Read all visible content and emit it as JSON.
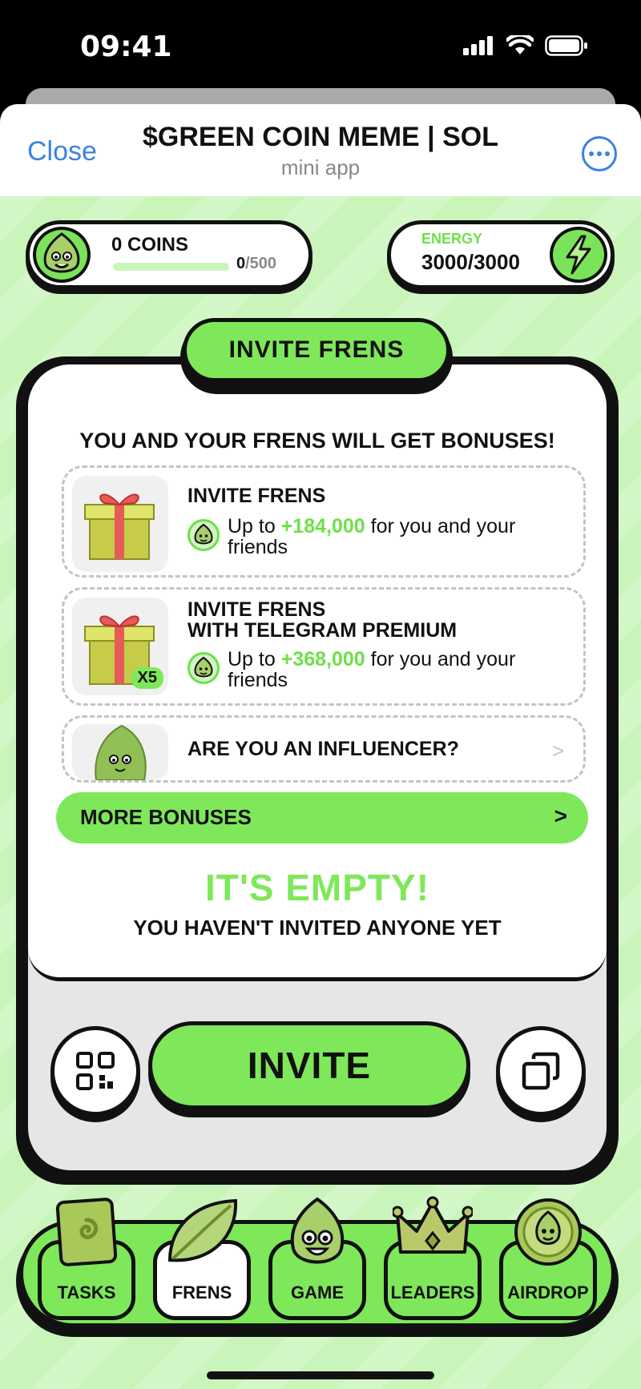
{
  "status_bar": {
    "time": "09:41"
  },
  "telegram": {
    "close_label": "Close",
    "title": "$GREEN COIN MEME | SOL",
    "subtitle": "mini app"
  },
  "coins": {
    "label": "0 COINS",
    "current": "0",
    "max": "/500",
    "progress": 0
  },
  "energy": {
    "label": "ENERGY",
    "value": "3000/3000"
  },
  "section_tab": "INVITE FRENS",
  "bonus_heading": "YOU AND YOUR FRENS WILL GET BONUSES!",
  "bonuses": [
    {
      "title": "INVITE FRENS",
      "prefix": "Up to ",
      "amount": "+184,000",
      "suffix": " for you and your friends"
    },
    {
      "title_line1": "INVITE FRENS",
      "title_line2": "WITH TELEGRAM PREMIUM",
      "badge": "X5",
      "prefix": "Up to ",
      "amount": "+368,000",
      "suffix": " for you and your friends"
    },
    {
      "title": "ARE YOU AN INFLUENCER?",
      "chevron": ">"
    }
  ],
  "more_bonuses": {
    "label": "MORE BONUSES",
    "chevron": ">"
  },
  "empty_state": {
    "title": "IT'S EMPTY!",
    "subtitle": "YOU HAVEN'T INVITED ANYONE YET"
  },
  "actions": {
    "invite_label": "INVITE",
    "qr_icon": "qr-code-icon",
    "copy_icon": "copy-icon"
  },
  "nav": {
    "items": [
      {
        "label": "TASKS",
        "icon": "tasks-icon",
        "active": false
      },
      {
        "label": "FRENS",
        "icon": "leaf-icon",
        "active": true
      },
      {
        "label": "GAME",
        "icon": "mascot-icon",
        "active": false
      },
      {
        "label": "LEADERS",
        "icon": "crown-icon",
        "active": false
      },
      {
        "label": "AIRDROP",
        "icon": "coin-icon",
        "active": false
      }
    ]
  },
  "colors": {
    "accent": "#7ee85a",
    "highlight": "#6ee04a",
    "background": "#c9f5bb",
    "link": "#3a82e0"
  }
}
